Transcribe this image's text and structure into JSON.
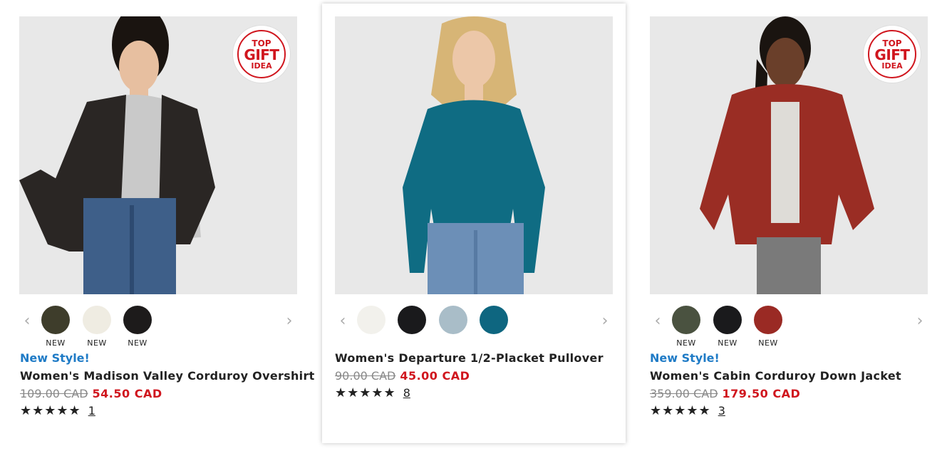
{
  "products": [
    {
      "badge": {
        "line1": "TOP",
        "line2": "GIFT",
        "line3": "IDEA"
      },
      "new_style_label": "New Style!",
      "name": "Women's Madison Valley Corduroy Overshirt",
      "original_price": "109.00 CAD",
      "sale_price": "54.50 CAD",
      "stars": "★★★★★",
      "review_count": "1",
      "swatches": [
        {
          "color": "#3e3d2b",
          "label": "NEW"
        },
        {
          "color": "#efece2",
          "label": "NEW"
        },
        {
          "color": "#1d1b1b",
          "label": "NEW"
        }
      ],
      "image_bg": "#e8e8e8"
    },
    {
      "name": "Women's Departure 1/2-Placket Pullover",
      "original_price": "90.00 CAD",
      "sale_price": "45.00 CAD",
      "stars": "★★★★★",
      "review_count": "8",
      "swatches": [
        {
          "color": "#f2f1ec",
          "label": ""
        },
        {
          "color": "#1a1a1c",
          "label": ""
        },
        {
          "color": "#a9bdc8",
          "label": ""
        },
        {
          "color": "#0e6680",
          "label": ""
        }
      ],
      "image_bg": "#e8e8e8"
    },
    {
      "badge": {
        "line1": "TOP",
        "line2": "GIFT",
        "line3": "IDEA"
      },
      "new_style_label": "New Style!",
      "name": "Women's Cabin Corduroy Down Jacket",
      "original_price": "359.00 CAD",
      "sale_price": "179.50 CAD",
      "stars": "★★★★★",
      "review_count": "3",
      "swatches": [
        {
          "color": "#4a5240",
          "label": "NEW"
        },
        {
          "color": "#1a1a1c",
          "label": "NEW"
        },
        {
          "color": "#9a2a24",
          "label": "NEW"
        }
      ],
      "image_bg": "#e8e8e8"
    }
  ],
  "nav": {
    "prev": "‹",
    "next": "›"
  },
  "colors": {
    "accent_blue": "#1f7bc6",
    "sale_red": "#d0161e"
  }
}
